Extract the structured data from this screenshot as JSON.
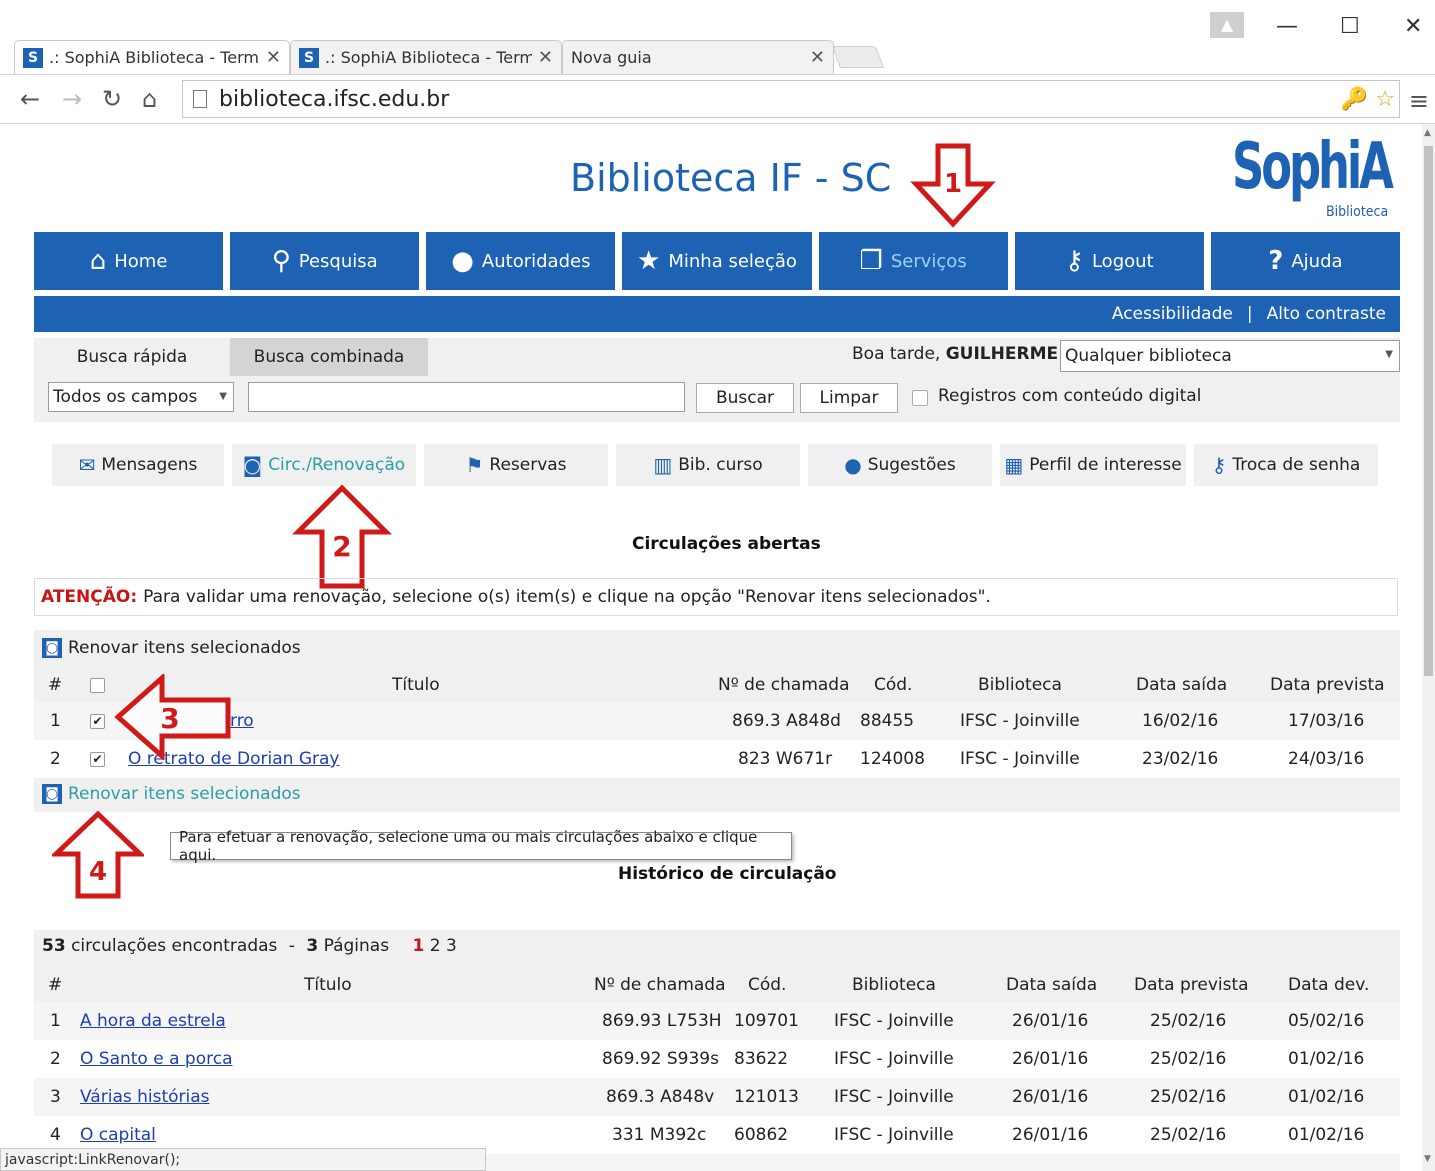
{
  "browser": {
    "tabs": [
      {
        "title": ".: SophiA Biblioteca - Term",
        "favicon": "S"
      },
      {
        "title": ".: SophiA Biblioteca - Term",
        "favicon": "S"
      },
      {
        "title": "Nova guia"
      }
    ],
    "url": "biblioteca.ifsc.edu.br",
    "status_text": "javascript:LinkRenovar();"
  },
  "header": {
    "site_title": "Biblioteca IF - SC",
    "logo_text": "SophiA",
    "logo_sub": "Biblioteca"
  },
  "main_nav": [
    {
      "label": "Home",
      "icon": "home-icon"
    },
    {
      "label": "Pesquisa",
      "icon": "search-icon"
    },
    {
      "label": "Autoridades",
      "icon": "user-icon"
    },
    {
      "label": "Minha seleção",
      "icon": "star-icon"
    },
    {
      "label": "Serviços",
      "icon": "copy-icon"
    },
    {
      "label": "Logout",
      "icon": "key-icon"
    },
    {
      "label": "Ajuda",
      "icon": "question-icon"
    }
  ],
  "accessibility": {
    "link1": "Acessibilidade",
    "separator": "|",
    "link2": "Alto contraste"
  },
  "search": {
    "tab_quick": "Busca rápida",
    "tab_combined": "Busca combinada",
    "greeting_prefix": "Boa tarde, ",
    "greeting_user": "GUILHERME!",
    "library_select": "Qualquer biblioteca",
    "field_select": "Todos os campos",
    "query": "",
    "search_button": "Buscar",
    "clear_button": "Limpar",
    "digital_label": "Registros com conteúdo digital"
  },
  "sub_nav": [
    {
      "label": "Mensagens",
      "icon": "envelope-icon"
    },
    {
      "label": "Circ./Renovação",
      "icon": "renew-icon"
    },
    {
      "label": "Reservas",
      "icon": "flag-icon"
    },
    {
      "label": "Bib. curso",
      "icon": "books-icon"
    },
    {
      "label": "Sugestões",
      "icon": "lightbulb-icon"
    },
    {
      "label": "Perfil de interesse",
      "icon": "grid-icon"
    },
    {
      "label": "Troca de senha",
      "icon": "key-icon"
    }
  ],
  "open_circulations": {
    "title": "Circulações abertas",
    "attention_label": "ATENÇÃO:",
    "attention_text": "Para validar uma renovação, selecione o(s) item(s) e clique na opção \"Renovar itens selecionados\".",
    "renew_label": "Renovar itens selecionados",
    "columns": [
      "#",
      "",
      "Título",
      "Nº de chamada",
      "Cód.",
      "Biblioteca",
      "Data saída",
      "Data prevista"
    ],
    "rows": [
      {
        "n": "1",
        "checked": "✔",
        "title": "rro",
        "call": "869.3 A848d",
        "code": "88455",
        "library": "IFSC - Joinville",
        "out": "16/02/16",
        "due": "17/03/16"
      },
      {
        "n": "2",
        "checked": "✔",
        "title": "O retrato de Dorian Gray",
        "call": "823 W671r",
        "code": "124008",
        "library": "IFSC - Joinville",
        "out": "23/02/16",
        "due": "24/03/16"
      }
    ],
    "tooltip": "Para efetuar a renovação, selecione uma ou mais circulações abaixo e clique aqui."
  },
  "history": {
    "title": "Histórico de circulação",
    "count": "53",
    "count_text": "circulações encontradas",
    "dash": "-",
    "pages": "3",
    "pages_text": "Páginas",
    "current_page": "1",
    "other_pages": "2 3",
    "columns": [
      "#",
      "Título",
      "Nº de chamada",
      "Cód.",
      "Biblioteca",
      "Data saída",
      "Data prevista",
      "Data dev."
    ],
    "rows": [
      {
        "n": "1",
        "title": "A hora da estrela",
        "call": "869.93 L753H",
        "code": "109701",
        "library": "IFSC - Joinville",
        "out": "26/01/16",
        "due": "25/02/16",
        "ret": "05/02/16"
      },
      {
        "n": "2",
        "title": "O Santo e a porca",
        "call": "869.92 S939s",
        "code": "83622",
        "library": "IFSC - Joinville",
        "out": "26/01/16",
        "due": "25/02/16",
        "ret": "01/02/16"
      },
      {
        "n": "3",
        "title": "Várias histórias",
        "call": "869.3 A848v",
        "code": "121013",
        "library": "IFSC - Joinville",
        "out": "26/01/16",
        "due": "25/02/16",
        "ret": "01/02/16"
      },
      {
        "n": "4",
        "title": "O capital",
        "call": "331 M392c",
        "code": "60862",
        "library": "IFSC - Joinville",
        "out": "26/01/16",
        "due": "25/02/16",
        "ret": "01/02/16"
      }
    ]
  },
  "annotations": [
    "1",
    "2",
    "3",
    "4"
  ],
  "colors": {
    "brand_blue": "#1d62b3",
    "annotation_red": "#d01a1a",
    "active_teal": "#2a9fa5",
    "attention_red": "#c81414"
  }
}
